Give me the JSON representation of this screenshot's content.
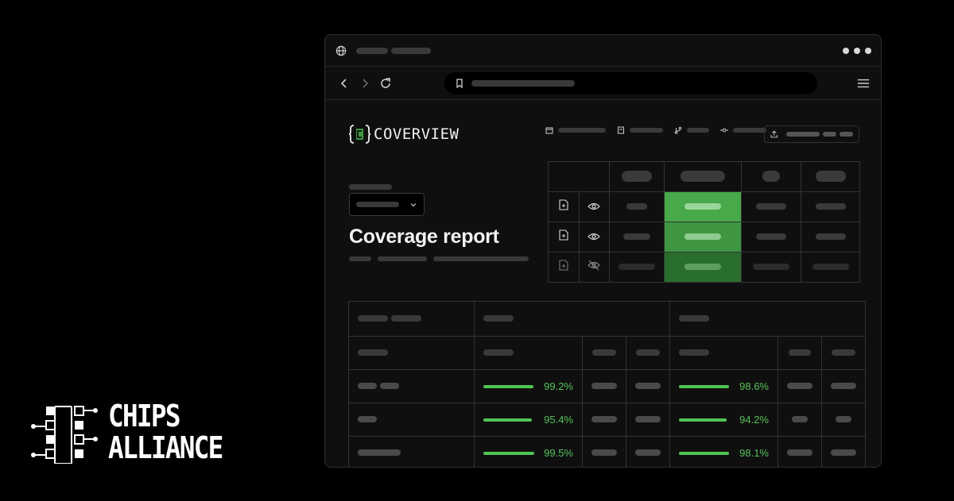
{
  "branding": {
    "line1": "CHIPS",
    "line2": "ALLIANCE",
    "logo_icon": "chips-alliance-circuit-icon"
  },
  "browser": {
    "icons": [
      "globe-icon",
      "more-dots-icon",
      "back-icon",
      "forward-icon",
      "reload-icon",
      "bookmark-icon",
      "menu-icon"
    ]
  },
  "app": {
    "logo_text": "COVERVIEW",
    "logo_icon": "coverview-brackets-icon",
    "meta_icons": [
      "calendar-icon",
      "file-icon",
      "branch-icon",
      "commit-icon",
      "upload-icon"
    ],
    "page_title": "Coverage report",
    "colors": {
      "accent": "#4fc552",
      "green_light": "#47a94a",
      "green_mid": "#3e9641",
      "green_dark": "#2a6e2d"
    }
  },
  "summary_table": {
    "rows": [
      {
        "file_icon": "file-plus-icon",
        "visibility_icon": "eye-icon"
      },
      {
        "file_icon": "file-plus-icon",
        "visibility_icon": "eye-icon"
      },
      {
        "file_icon": "file-plus-icon",
        "visibility_icon": "eye-off-icon"
      }
    ]
  },
  "coverage_table": {
    "rows": [
      {
        "cov1": "99.2%",
        "cov1_fraction": 0.992,
        "cov2": "98.6%",
        "cov2_fraction": 0.986
      },
      {
        "cov1": "95.4%",
        "cov1_fraction": 0.954,
        "cov2": "94.2%",
        "cov2_fraction": 0.942
      },
      {
        "cov1": "99.5%",
        "cov1_fraction": 0.995,
        "cov2": "98.1%",
        "cov2_fraction": 0.981
      }
    ]
  }
}
